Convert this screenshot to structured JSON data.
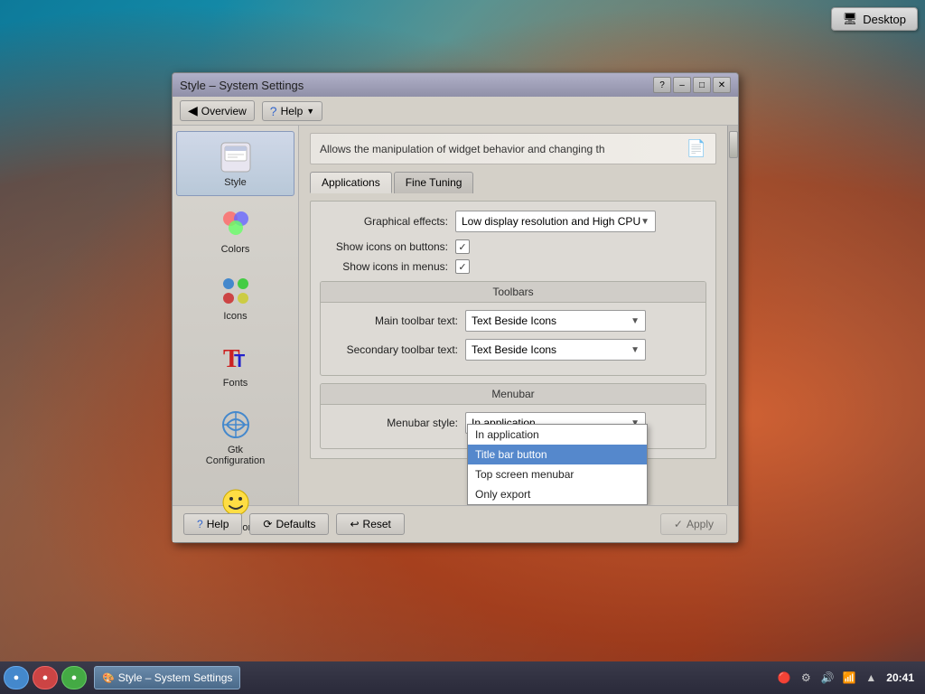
{
  "desktop": {
    "btn_label": "Desktop"
  },
  "dialog": {
    "title": "Style – System Settings",
    "description": "Allows the manipulation of widget behavior and changing th",
    "tabs": [
      {
        "id": "applications",
        "label": "Applications",
        "active": true
      },
      {
        "id": "fine_tuning",
        "label": "Fine Tuning",
        "active": false
      }
    ],
    "graphical_effects_label": "Graphical effects:",
    "graphical_effects_value": "Low display resolution and High CPU",
    "show_icons_buttons_label": "Show icons on buttons:",
    "show_icons_menus_label": "Show icons in menus:",
    "toolbars_title": "Toolbars",
    "main_toolbar_label": "Main toolbar text:",
    "main_toolbar_value": "Text Beside Icons",
    "secondary_toolbar_label": "Secondary toolbar text:",
    "secondary_toolbar_value": "Text Beside Icons",
    "menubar_title": "Menubar",
    "menubar_style_label": "Menubar style:",
    "menubar_style_value": "In application",
    "menubar_options": [
      {
        "value": "in_application",
        "label": "In application"
      },
      {
        "value": "title_bar_button",
        "label": "Title bar button",
        "selected": true
      },
      {
        "value": "top_screen_menubar",
        "label": "Top screen menubar"
      },
      {
        "value": "only_export",
        "label": "Only export"
      }
    ],
    "buttons": {
      "help": "Help",
      "defaults": "Defaults",
      "reset": "Reset",
      "apply": "Apply"
    }
  },
  "sidebar": {
    "items": [
      {
        "id": "style",
        "label": "Style",
        "icon": "🎨",
        "active": true
      },
      {
        "id": "colors",
        "label": "Colors",
        "icon": "🎨"
      },
      {
        "id": "icons",
        "label": "Icons",
        "icon": "🔵"
      },
      {
        "id": "fonts",
        "label": "Fonts",
        "icon": "T"
      },
      {
        "id": "gtk_configuration",
        "label": "Gtk\nConfiguration",
        "icon": "🌐"
      },
      {
        "id": "emoticons",
        "label": "Emoticons",
        "icon": "😊"
      }
    ]
  },
  "taskbar": {
    "app_label": "Style – System Settings",
    "time": "20:41",
    "tray_icons": [
      "▲",
      "🔔",
      "📱",
      "📶"
    ]
  }
}
